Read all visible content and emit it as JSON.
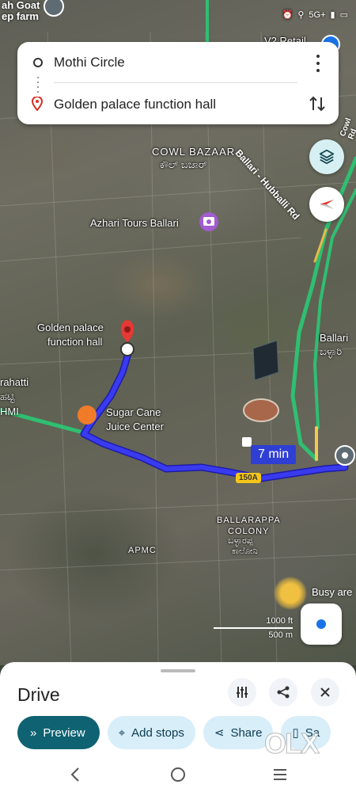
{
  "status_bar": {
    "top_left_line1": "ah Goat",
    "top_left_line2": "ep farm",
    "network": "5G+",
    "alarm_icon": "alarm-icon",
    "signal_icon": "signal-icon",
    "battery_icon": "battery-icon"
  },
  "route": {
    "origin": "Mothi Circle",
    "destination": "Golden palace function hall"
  },
  "map": {
    "labels": {
      "cowl_bazaar_en": "COWL BAZAAR",
      "cowl_bazaar_kn": "ಕೌಲ್ ಬಜಾರ್",
      "azhari": "Azhari Tours Ballari",
      "golden_palace_line1": "Golden palace",
      "golden_palace_line2": "function hall",
      "sugar_cane_line1": "Sugar Cane",
      "sugar_cane_line2": "Juice Center",
      "ballari_hubballi_rd": "Ballari - Hubballi Rd",
      "ballari_en": "Ballari",
      "ballari_kn": "ಬಳ್ಳಾರಿ",
      "rahatti_line1": "rahatti",
      "rahatti_line2": "ಹಟ್ಟಿ",
      "hmi": "HMI",
      "ballarappa_line1": "BALLARAPPA",
      "ballarappa_line2": "COLONY",
      "ballarappa_kn1": "ಬಳ್ಳಾರಪ್ಪ",
      "ballarappa_kn2": "ಕಾಲೋನಿ",
      "apmc": "APMC",
      "busy_area": "Busy are",
      "v2_retail": "V2 Retail",
      "cowl_rd": "Cowl Rd"
    },
    "eta": "7 min",
    "highway_shield": "150A",
    "scale_ft": "1000 ft",
    "scale_m": "500 m",
    "route_color": "#2e2fd6",
    "traffic_color": "#2fbf71"
  },
  "sheet": {
    "title": "Drive",
    "buttons": {
      "preview": "Preview",
      "add_stops": "Add stops",
      "share": "Share",
      "save": "Sa"
    }
  },
  "watermark": "OLX"
}
